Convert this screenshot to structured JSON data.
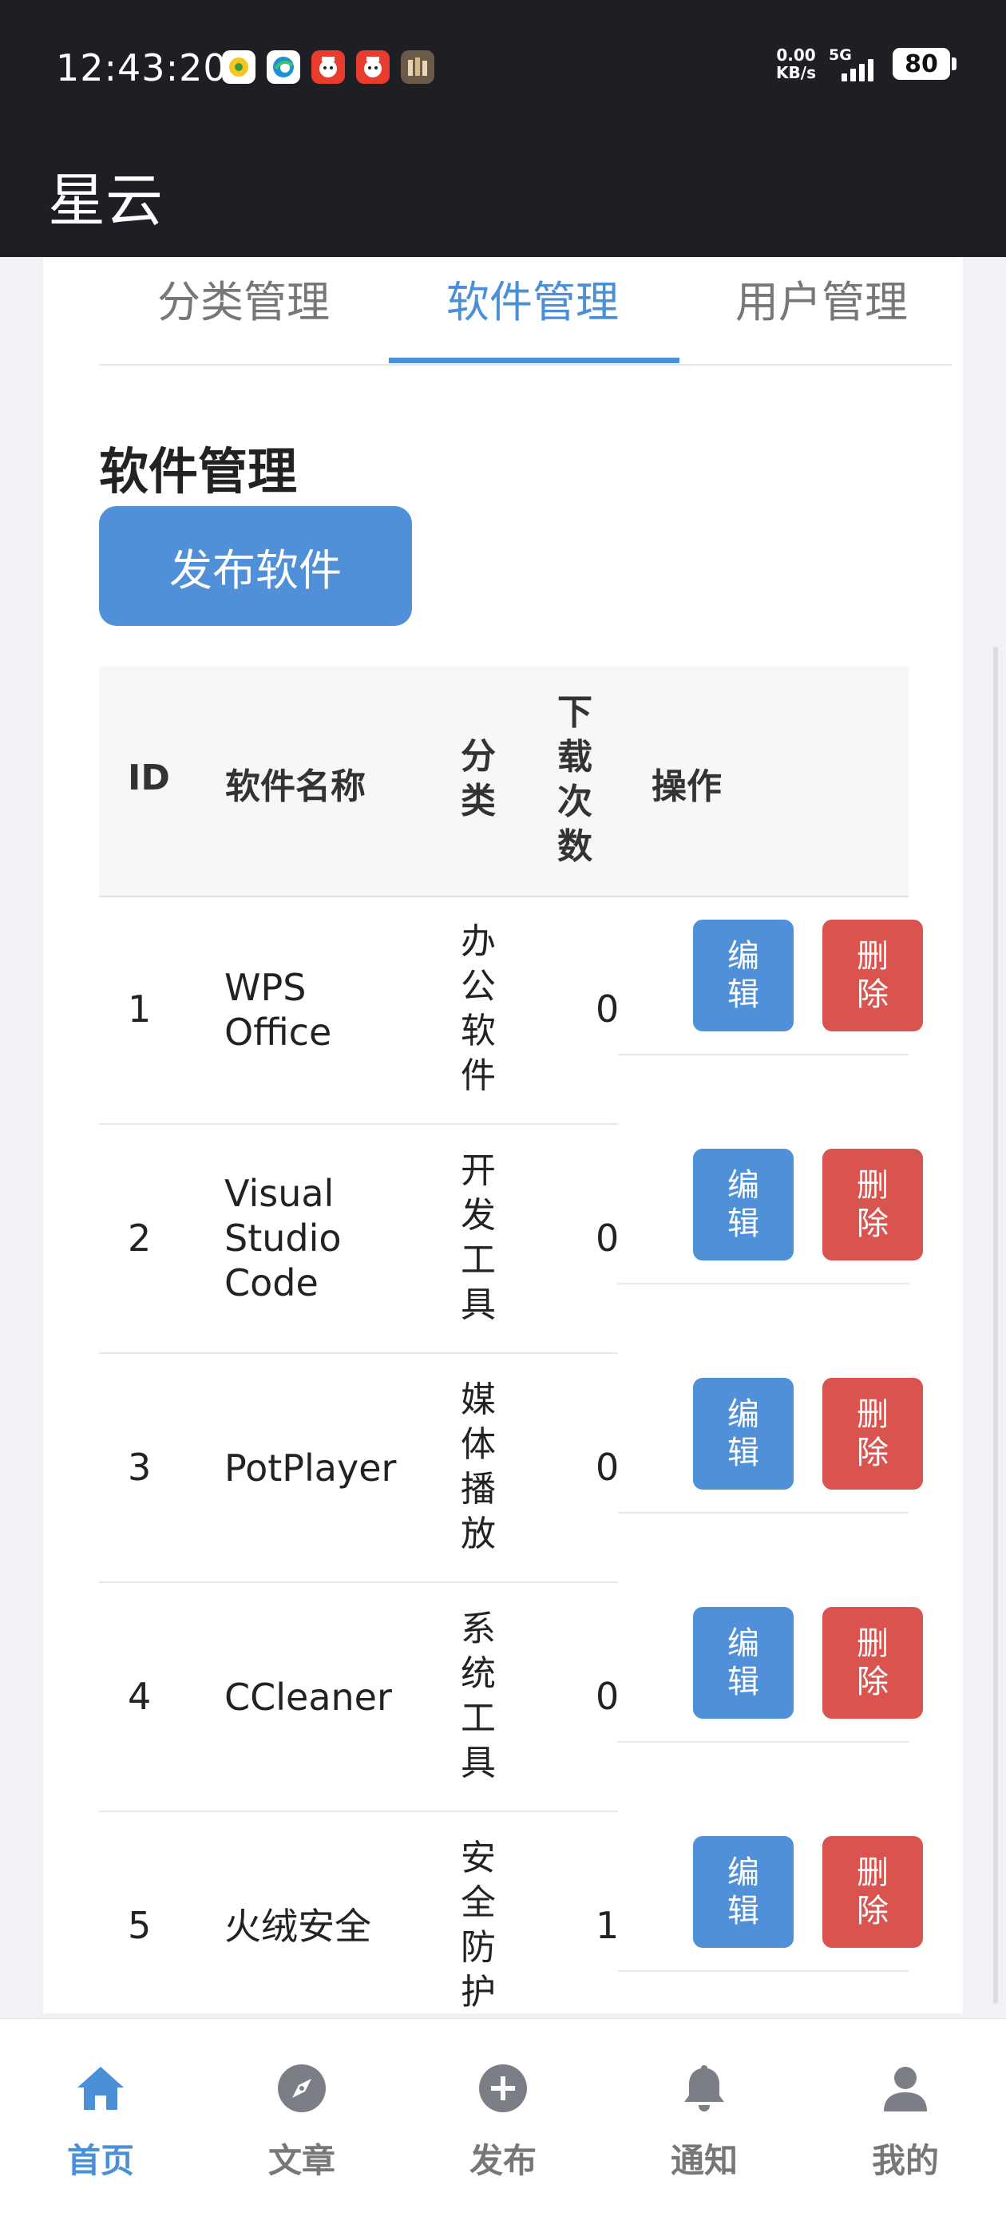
{
  "status_bar": {
    "time": "12:43:20",
    "net_speed_value": "0.00",
    "net_speed_unit": "KB/s",
    "network": "5G",
    "battery": "80",
    "notification_icons": [
      "app-icon-yellow",
      "edge-browser-icon",
      "red-app-icon",
      "red-app-icon",
      "game-app-icon"
    ]
  },
  "app": {
    "title": "星云"
  },
  "tabs": [
    {
      "label": "分类管理",
      "active": false
    },
    {
      "label": "软件管理",
      "active": true
    },
    {
      "label": "用户管理",
      "active": false
    }
  ],
  "section": {
    "title": "软件管理",
    "publish_button": "发布软件"
  },
  "table": {
    "headers": [
      "ID",
      "软件名称",
      "分类",
      "下载次数",
      "操作"
    ],
    "rows": [
      {
        "id": "1",
        "name": "WPS Office",
        "category": "办公软件",
        "downloads": "0",
        "edit": "编辑",
        "delete": "删除"
      },
      {
        "id": "2",
        "name": "Visual Studio Code",
        "category": "开发工具",
        "downloads": "0",
        "edit": "编辑",
        "delete": "删除"
      },
      {
        "id": "3",
        "name": "PotPlayer",
        "category": "媒体播放",
        "downloads": "0",
        "edit": "编辑",
        "delete": "删除"
      },
      {
        "id": "4",
        "name": "CCleaner",
        "category": "系统工具",
        "downloads": "0",
        "edit": "编辑",
        "delete": "删除"
      },
      {
        "id": "5",
        "name": "火绒安全",
        "category": "安全防护",
        "downloads": "1",
        "edit": "编辑",
        "delete": "删除"
      }
    ]
  },
  "bottom_nav": [
    {
      "label": "首页",
      "icon": "home-icon",
      "active": true
    },
    {
      "label": "文章",
      "icon": "compass-icon",
      "active": false
    },
    {
      "label": "发布",
      "icon": "plus-circle-icon",
      "active": false
    },
    {
      "label": "通知",
      "icon": "bell-icon",
      "active": false
    },
    {
      "label": "我的",
      "icon": "user-icon",
      "active": false
    }
  ],
  "colors": {
    "primary": "#4f90d9",
    "danger": "#d9534f",
    "header_bg": "#1e1f24",
    "active_tab": "#4a8fd8"
  }
}
